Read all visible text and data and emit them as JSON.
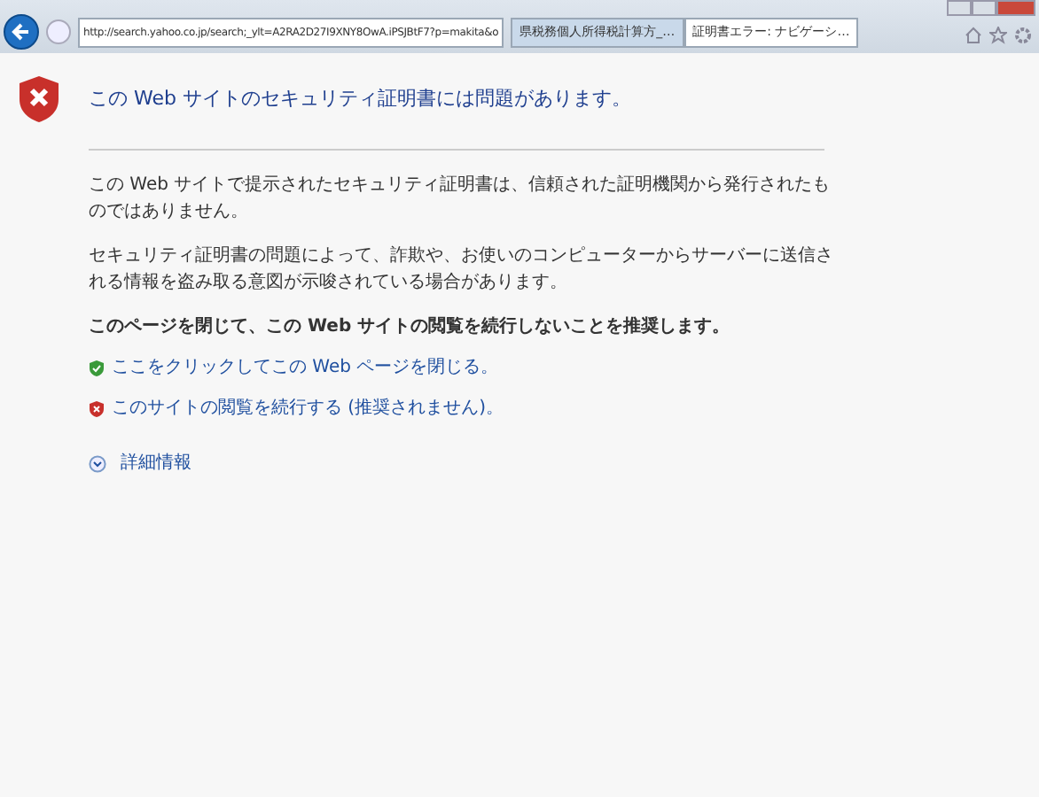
{
  "address_bar": {
    "url": "http://search.yahoo.co.jp/search;_ylt=A2RA2D27I9XNY8OwA.iPSJBtF7?p=makita&o"
  },
  "tabs": [
    {
      "label": "県税務個人所得税計算方_…",
      "selected": false
    },
    {
      "label": "証明書エラー: ナビゲーシ…",
      "selected": true
    }
  ],
  "page": {
    "title": "この Web サイトのセキュリティ証明書には問題があります。",
    "paragraphs": [
      "この Web サイトで提示されたセキュリティ証明書は、信頼された証明機関から発行されたものではありません。",
      "セキュリティ証明書の問題によって、詐欺や、お使いのコンピューターからサーバーに送信される情報を盗み取る意図が示唆されている場合があります。"
    ],
    "recommendation": "このページを閉じて、この Web サイトの閲覧を続行しないことを推奨します。",
    "links": [
      {
        "kind": "safe",
        "label": "ここをクリックしてこの Web ページを閉じる。"
      },
      {
        "kind": "unsafe",
        "label": "このサイトの閲覧を続行する (推奨されません)。"
      }
    ],
    "more_info": "詳細情報"
  }
}
